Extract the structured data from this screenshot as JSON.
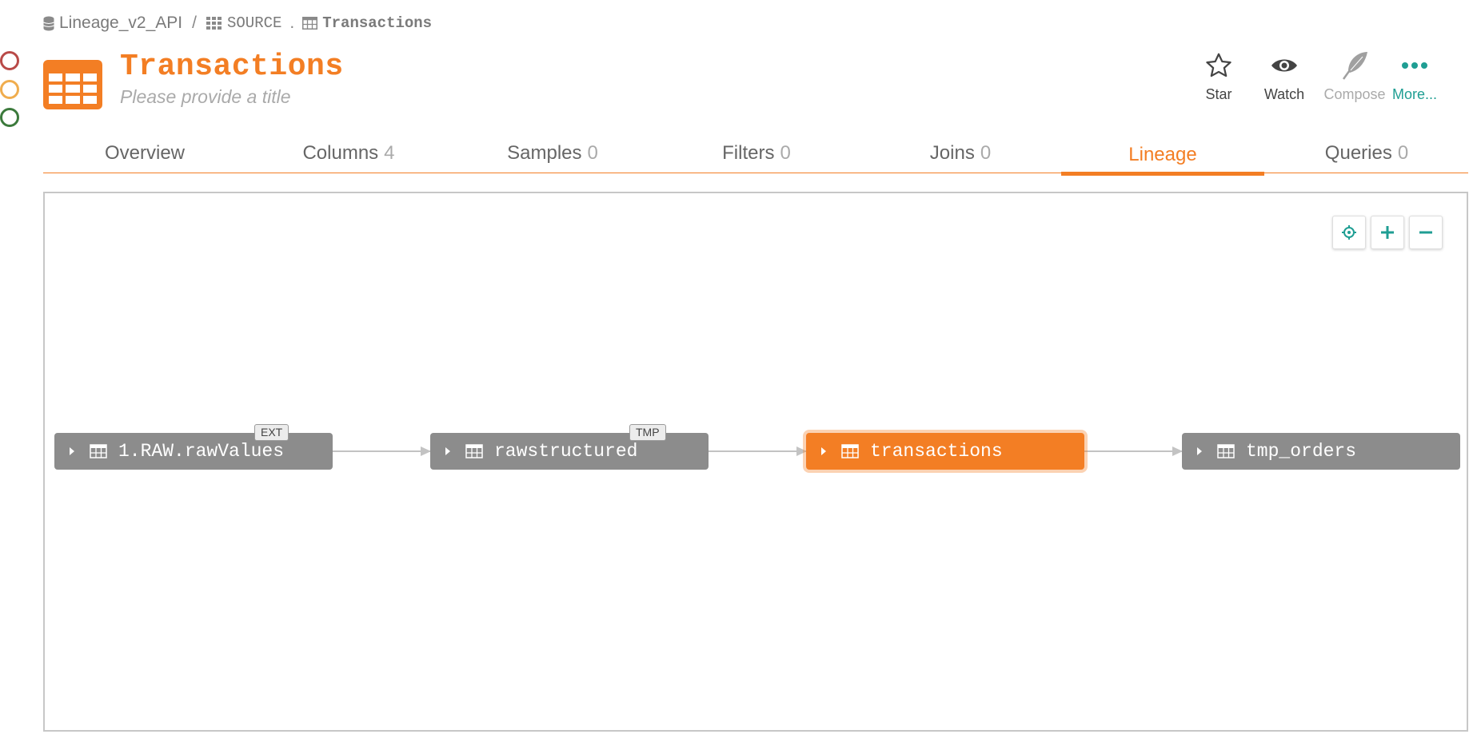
{
  "breadcrumb": {
    "database": "Lineage_v2_API",
    "separator": "/",
    "schema": "SOURCE",
    "dot": ".",
    "table": "Transactions"
  },
  "header": {
    "title": "Transactions",
    "subtitle": "Please provide a title"
  },
  "actions": [
    {
      "label": "Star",
      "icon": "star-icon"
    },
    {
      "label": "Watch",
      "icon": "eye-icon"
    },
    {
      "label": "Compose",
      "icon": "feather-icon"
    },
    {
      "label": "More...",
      "icon": "more-dots-icon"
    }
  ],
  "tabs": [
    {
      "label": "Overview",
      "count": ""
    },
    {
      "label": "Columns",
      "count": "4"
    },
    {
      "label": "Samples",
      "count": "0"
    },
    {
      "label": "Filters",
      "count": "0"
    },
    {
      "label": "Joins",
      "count": "0"
    },
    {
      "label": "Lineage",
      "count": "",
      "active": true
    },
    {
      "label": "Queries",
      "count": "0"
    }
  ],
  "lineage": {
    "nodes": [
      {
        "label": "1.RAW.rawValues",
        "badge": "EXT"
      },
      {
        "label": "rawstructured",
        "badge": "TMP"
      },
      {
        "label": "transactions",
        "badge": "",
        "active": true
      },
      {
        "label": "tmp_orders",
        "badge": ""
      }
    ],
    "controls": [
      "center-icon",
      "zoom-in-icon",
      "zoom-out-icon"
    ]
  },
  "colors": {
    "accent": "#f37e24",
    "node_gray": "#8c8c8c",
    "teal": "#1f9e93",
    "status_red": "#b94a48",
    "status_yellow": "#f0ad4e",
    "status_green": "#3c7a3c"
  }
}
